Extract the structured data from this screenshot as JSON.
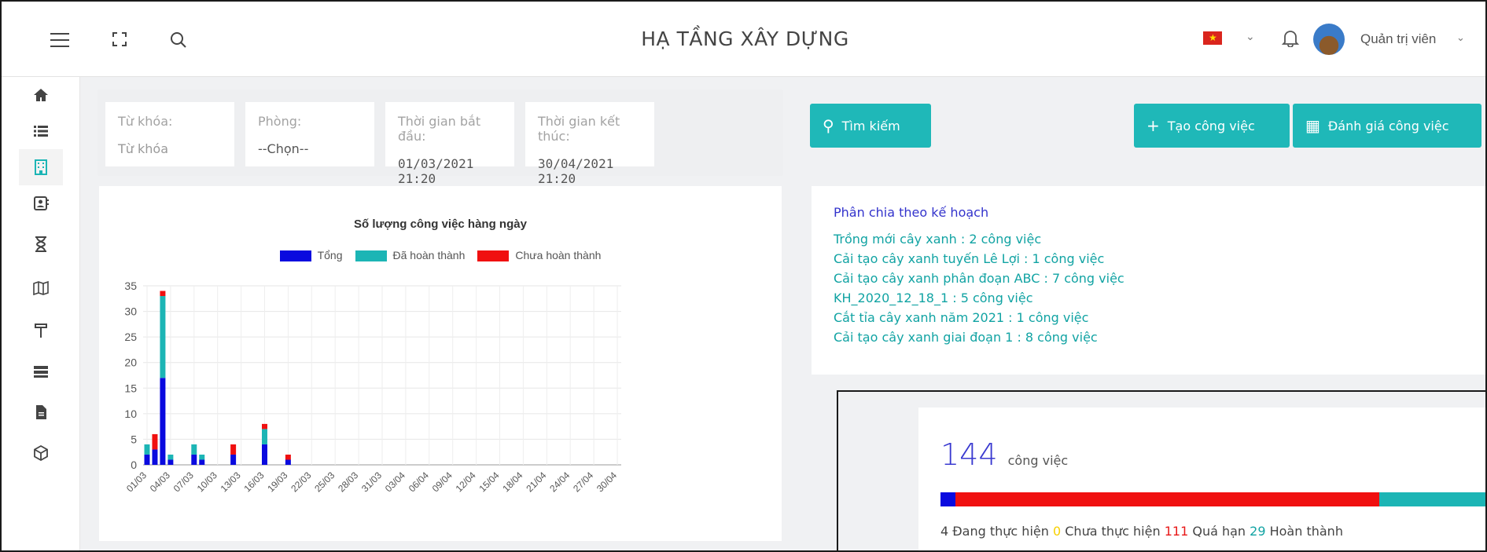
{
  "header": {
    "title": "HẠ TẦNG XÂY DỰNG",
    "user_name": "Quản trị viên"
  },
  "filters": {
    "keyword": {
      "label": "Từ khóa:",
      "placeholder": "Từ khóa"
    },
    "room": {
      "label": "Phòng:",
      "value": "--Chọn--"
    },
    "start": {
      "label": "Thời gian bắt đầu:",
      "value": "01/03/2021 21:20"
    },
    "end": {
      "label": "Thời gian kết thúc:",
      "value": "30/04/2021 21:20"
    }
  },
  "buttons": {
    "search": "Tìm kiếm",
    "create": "Tạo công việc",
    "evaluate": "Đánh giá công việc"
  },
  "colors": {
    "teal": "#1fb8b8",
    "blue": "#0a0adf",
    "red": "#f01010",
    "series_done": "#1cb5b5"
  },
  "chart_data": {
    "type": "bar",
    "title": "Số lượng công việc hàng ngày",
    "stacked": true,
    "ylim": [
      0,
      35
    ],
    "yticks": [
      0,
      5,
      10,
      15,
      20,
      25,
      30,
      35
    ],
    "x_tick_labels": [
      "01/03",
      "04/03",
      "07/03",
      "10/03",
      "13/03",
      "16/03",
      "19/03",
      "22/03",
      "25/03",
      "28/03",
      "31/03",
      "03/04",
      "06/04",
      "09/04",
      "12/04",
      "15/04",
      "18/04",
      "21/04",
      "24/04",
      "27/04",
      "30/04"
    ],
    "categories": [
      "01/03",
      "02/03",
      "03/03",
      "04/03",
      "05/03",
      "06/03",
      "07/03",
      "08/03",
      "09/03",
      "10/03",
      "11/03",
      "12/03",
      "13/03",
      "14/03",
      "15/03",
      "16/03",
      "17/03",
      "18/03",
      "19/03",
      "20/03",
      "21/03",
      "22/03",
      "23/03",
      "24/03",
      "25/03",
      "26/03",
      "27/03",
      "28/03",
      "29/03",
      "30/03",
      "31/03",
      "01/04",
      "02/04",
      "03/04",
      "04/04",
      "05/04",
      "06/04",
      "07/04",
      "08/04",
      "09/04",
      "10/04",
      "11/04",
      "12/04",
      "13/04",
      "14/04",
      "15/04",
      "16/04",
      "17/04",
      "18/04",
      "19/04",
      "20/04",
      "21/04",
      "22/04",
      "23/04",
      "24/04",
      "25/04",
      "26/04",
      "27/04",
      "28/04",
      "29/04",
      "30/04"
    ],
    "series": [
      {
        "name": "Tổng",
        "color": "#0a0adf",
        "values": [
          2,
          3,
          17,
          1,
          0,
          0,
          2,
          1,
          0,
          0,
          0,
          2,
          0,
          0,
          0,
          4,
          0,
          0,
          1,
          0,
          0,
          0,
          0,
          0,
          0,
          0,
          0,
          0,
          0,
          0,
          0,
          0,
          0,
          0,
          0,
          0,
          0,
          0,
          0,
          0,
          0,
          0,
          0,
          0,
          0,
          0,
          0,
          0,
          0,
          0,
          0,
          0,
          0,
          0,
          0,
          0,
          0,
          0,
          0,
          0,
          0
        ]
      },
      {
        "name": "Đã hoàn thành",
        "color": "#1cb5b5",
        "values": [
          2,
          0,
          16,
          1,
          0,
          0,
          2,
          1,
          0,
          0,
          0,
          0,
          0,
          0,
          0,
          3,
          0,
          0,
          0,
          0,
          0,
          0,
          0,
          0,
          0,
          0,
          0,
          0,
          0,
          0,
          0,
          0,
          0,
          0,
          0,
          0,
          0,
          0,
          0,
          0,
          0,
          0,
          0,
          0,
          0,
          0,
          0,
          0,
          0,
          0,
          0,
          0,
          0,
          0,
          0,
          0,
          0,
          0,
          0,
          0,
          0
        ]
      },
      {
        "name": "Chưa hoàn thành",
        "color": "#f01010",
        "values": [
          0,
          3,
          1,
          0,
          0,
          0,
          0,
          0,
          0,
          0,
          0,
          2,
          0,
          0,
          0,
          1,
          0,
          0,
          1,
          0,
          0,
          0,
          0,
          0,
          0,
          0,
          0,
          0,
          0,
          0,
          0,
          0,
          0,
          0,
          0,
          0,
          0,
          0,
          0,
          0,
          0,
          0,
          0,
          0,
          0,
          0,
          0,
          0,
          0,
          0,
          0,
          0,
          0,
          0,
          0,
          0,
          0,
          0,
          0,
          0,
          0
        ]
      }
    ],
    "legend": "top-center",
    "grid": true
  },
  "plan": {
    "heading": "Phân chia theo kế hoạch",
    "items": [
      "Trồng mới cây xanh : 2 công việc",
      "Cải tạo cây xanh tuyến Lê Lợi : 1 công việc",
      "Cải tạo cây xanh phân đoạn ABC : 7 công việc",
      "KH_2020_12_18_1 : 5 công việc",
      "Cắt tỉa cây xanh năm 2021 : 1 công việc",
      "Cải tạo cây xanh giai đoạn 1 : 8 công việc"
    ]
  },
  "stats": {
    "total": "144",
    "unit": "công việc",
    "in_progress": "4",
    "in_progress_label": "Đang thực hiện",
    "not_started": "0",
    "not_started_label": "Chưa thực hiện",
    "overdue": "111",
    "overdue_label": "Quá hạn",
    "done": "29",
    "done_label": "Hoàn thành",
    "bar_fractions": {
      "in_progress": 0.0278,
      "overdue": 0.7708,
      "done": 0.2014
    }
  }
}
